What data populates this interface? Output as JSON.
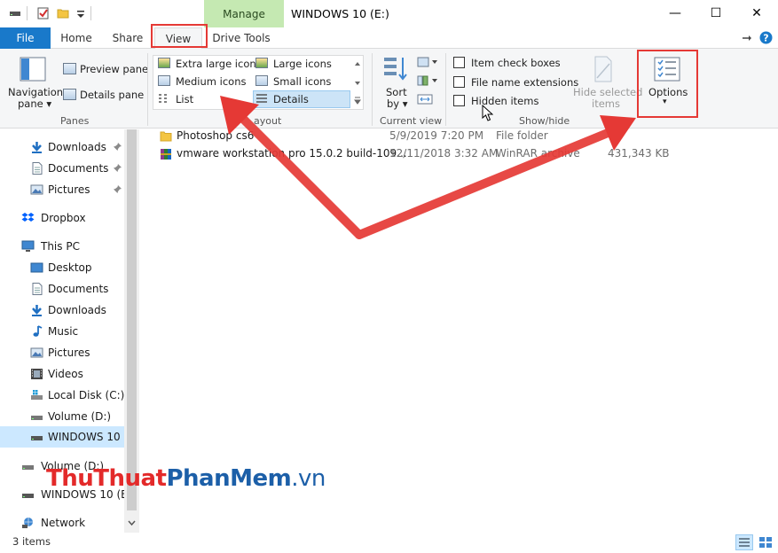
{
  "window": {
    "title": "WINDOWS 10 (E:)",
    "context_tab": "Manage",
    "minimize_glyph": "—",
    "maximize_glyph": "☐",
    "close_glyph": "✕"
  },
  "tabs": {
    "file": "File",
    "home": "Home",
    "share": "Share",
    "view": "View",
    "drive_tools": "Drive Tools"
  },
  "ribbon": {
    "panes": {
      "navigation_pane": "Navigation",
      "navigation_pane_2": "pane ▾",
      "preview_pane": "Preview pane",
      "details_pane": "Details pane",
      "label": "Panes"
    },
    "layout": {
      "extra_large_icons": "Extra large icons",
      "large_icons": "Large icons",
      "medium_icons": "Medium icons",
      "small_icons": "Small icons",
      "list": "List",
      "details": "Details",
      "label": "ayout"
    },
    "current_view": {
      "sort_by": "Sort",
      "sort_by_2": "by ▾",
      "label": "Current view"
    },
    "show_hide": {
      "item_check_boxes": "Item check boxes",
      "file_name_extensions": "File name extensions",
      "hidden_items": "Hidden items",
      "hide_selected": "Hide selected",
      "hide_selected_2": "items",
      "label": "Show/hide"
    },
    "options": {
      "label": "Options",
      "arrow": "▾"
    }
  },
  "nav": {
    "items": [
      {
        "label": "Downloads",
        "pinned": true
      },
      {
        "label": "Documents",
        "pinned": true
      },
      {
        "label": "Pictures",
        "pinned": true
      },
      {
        "label": "Dropbox"
      },
      {
        "label": "This PC"
      },
      {
        "label": "Desktop"
      },
      {
        "label": "Documents"
      },
      {
        "label": "Downloads"
      },
      {
        "label": "Music"
      },
      {
        "label": "Pictures"
      },
      {
        "label": "Videos"
      },
      {
        "label": "Local Disk (C:)"
      },
      {
        "label": "Volume (D:)"
      },
      {
        "label": "WINDOWS 10 (E"
      },
      {
        "label": "Volume (D:)"
      },
      {
        "label": "WINDOWS 10 (E:)"
      },
      {
        "label": "Network"
      }
    ]
  },
  "files": [
    {
      "name": "Photoshop cs6",
      "date": "5/9/2019 7:20 PM",
      "type": "File folder",
      "size": ""
    },
    {
      "name": "vmware workstation pro 15.0.2 build-109...",
      "date": "12/11/2018 3:32 AM",
      "type": "WinRAR archive",
      "size": "431,343 KB"
    }
  ],
  "status": {
    "count": "3 items"
  },
  "watermark": {
    "part1": "ThuThuat",
    "part2": "PhanMem",
    "part3": ".vn"
  },
  "colors": {
    "file_tab": "#1979ca",
    "manage_tab": "#c5e9b2",
    "highlight": "#e53935",
    "selection": "#cce8ff"
  }
}
